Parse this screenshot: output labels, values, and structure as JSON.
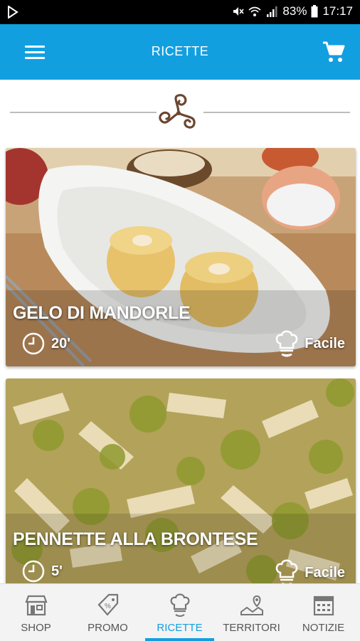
{
  "status_bar": {
    "battery": "83%",
    "time": "17:17"
  },
  "app_bar": {
    "title": "RICETTE"
  },
  "recipes": [
    {
      "title": "GELO DI MANDORLE",
      "time": "20'",
      "difficulty": "Facile"
    },
    {
      "title": "PENNETTE ALLA BRONTESE",
      "time": "5'",
      "difficulty": "Facile"
    }
  ],
  "bottom_nav": [
    {
      "label": "SHOP",
      "icon": "shop-icon"
    },
    {
      "label": "PROMO",
      "icon": "promo-tag-icon"
    },
    {
      "label": "RICETTE",
      "icon": "chef-hat-icon",
      "active": true
    },
    {
      "label": "TERRITORI",
      "icon": "map-icon"
    },
    {
      "label": "NOTIZIE",
      "icon": "calendar-icon"
    }
  ],
  "colors": {
    "primary": "#129fe0",
    "ornament": "#6b4630"
  }
}
